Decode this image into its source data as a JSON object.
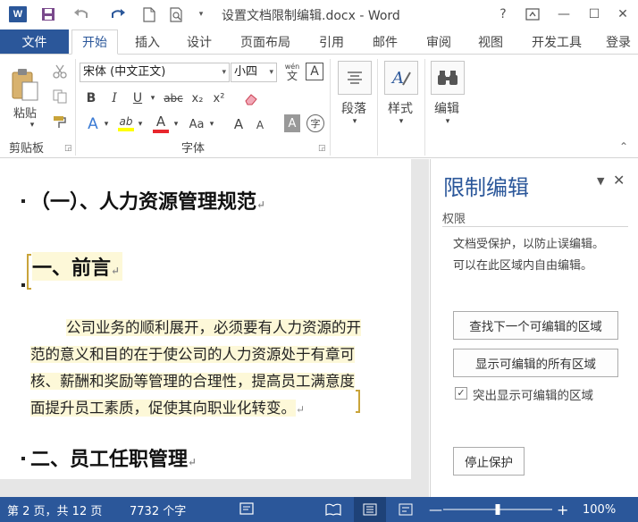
{
  "window": {
    "title": "设置文档限制编辑.docx - Word",
    "app_logo": "W",
    "help": "?",
    "restore_icon": "ribbon-display-icon",
    "minimize": "—",
    "maximize": "☐",
    "close": "✕"
  },
  "tabs": {
    "file": "文件",
    "items": [
      "开始",
      "插入",
      "设计",
      "页面布局",
      "引用",
      "邮件",
      "审阅",
      "视图",
      "开发工具",
      "登录"
    ],
    "active": "开始"
  },
  "ribbon": {
    "clipboard": {
      "paste": "粘贴",
      "label": "剪贴板"
    },
    "font": {
      "name": "宋体 (中文正文)",
      "size": "小四",
      "label": "字体",
      "pinyin_top": "wén",
      "pinyin_char": "文",
      "border_char": "A",
      "bold": "B",
      "italic": "I",
      "underline": "U",
      "strike": "abc",
      "subscript": "x₂",
      "superscript": "x²",
      "font_color": "A",
      "highlight": "ab",
      "case": "Aa",
      "grow": "A",
      "shrink": "A",
      "shade": "A",
      "circle": "字"
    },
    "paragraph": {
      "label": "段落"
    },
    "styles": {
      "label": "样式"
    },
    "editing": {
      "label": "编辑"
    }
  },
  "document": {
    "heading1": "（一）、人力资源管理规范",
    "heading2": "一、前言",
    "para_lines": [
      "公司业务的顺利展开，必须要有人力资源的开",
      "范的意义和目的在于使公司的人力资源处于有章可",
      "核、薪酬和奖励等管理的合理性，提高员工满意度",
      "面提升员工素质，促使其向职业化转变。"
    ],
    "heading3": "二、员工任职管理"
  },
  "pane": {
    "title": "限制编辑",
    "section": "权限",
    "desc_line1": "文档受保护，以防止误编辑。",
    "desc_line2": "可以在此区域内自由编辑。",
    "find_next": "查找下一个可编辑的区域",
    "show_all": "显示可编辑的所有区域",
    "highlight_label": "突出显示可编辑的区域",
    "highlight_checked": true,
    "stop_protect": "停止保护"
  },
  "status": {
    "page": "第 2 页，共 12 页",
    "words": "7732 个字",
    "zoom": "100%",
    "zoom_value": 100
  },
  "colors": {
    "accent": "#2b579a",
    "highlight_bg": "#fdf8d8",
    "bracket": "#c9a43a"
  }
}
